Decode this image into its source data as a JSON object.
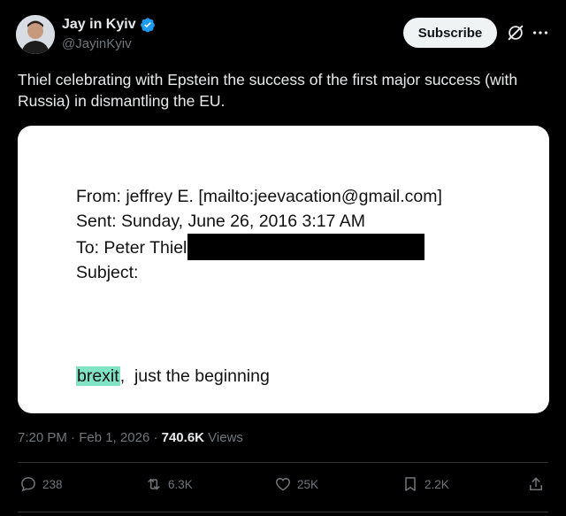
{
  "author": {
    "display_name": "Jay in Kyiv",
    "handle": "@JayinKyiv",
    "verified_icon": "verified-badge-icon",
    "badge_color": "#1d9bf0"
  },
  "header": {
    "subscribe_label": "Subscribe",
    "grok_icon": "grok-icon",
    "more_icon": "more-icon"
  },
  "tweet": {
    "text": "Thiel celebrating with Epstein the success of the first major success (with Russia) in dismantling the EU."
  },
  "media": {
    "email": {
      "from_line": "From: jeffrey E. [mailto:jeevacation@gmail.com]",
      "sent_line": "Sent: Sunday, June 26, 2016 3:17 AM",
      "to_line": "To: Peter Thiel",
      "subject_line": "Subject:",
      "body_highlight": "brexit",
      "body_rest": ",  just the beginning",
      "highlight_color": "#7fe3c4"
    }
  },
  "meta": {
    "time": "7:20 PM",
    "separator": " · ",
    "date": "Feb 1, 2026",
    "views_count": "740.6K",
    "views_label": " Views"
  },
  "actions": {
    "replies": "238",
    "reposts": "6.3K",
    "likes": "25K",
    "bookmarks": "2.2K"
  }
}
